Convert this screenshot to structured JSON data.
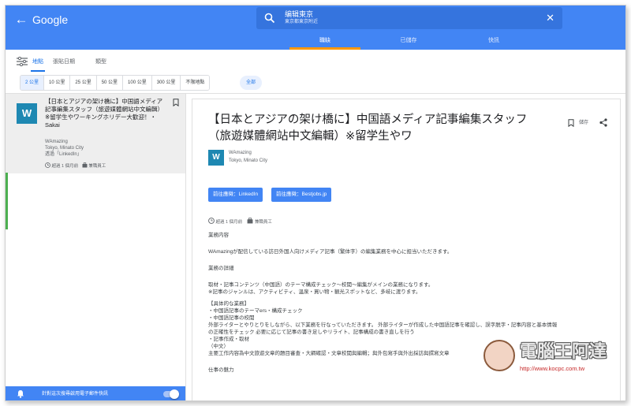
{
  "header": {
    "brand": "Google",
    "search_title": "编辑東京",
    "search_sub": "東京都東京附近",
    "tabs": [
      {
        "label": "職缺"
      },
      {
        "label": "已儲存"
      },
      {
        "label": "快訊"
      }
    ]
  },
  "filters": {
    "tabs": [
      {
        "label": "地點"
      },
      {
        "label": "張貼日期"
      },
      {
        "label": "類型"
      }
    ],
    "distances": [
      {
        "label": "2 公里"
      },
      {
        "label": "10 公里"
      },
      {
        "label": "25 公里"
      },
      {
        "label": "50 公里"
      },
      {
        "label": "100 公里"
      },
      {
        "label": "300 公里"
      },
      {
        "label": "不限地點"
      }
    ],
    "all_label": "全部"
  },
  "list": {
    "card": {
      "logo_letter": "W",
      "title": "【日本とアジアの架け橋に】中国語メディア記事編集スタッフ（旅遊媒體網站中文編輯）※留学生やワーキングホリデー大歓迎！・Sakai",
      "company": "WAmazing",
      "location": "Tokyo, Minato City",
      "via": "透過「LinkedIn」",
      "posted": "超過 1 個月前",
      "type": "full-time"
    },
    "type_label": "兼職員工"
  },
  "notify": {
    "text": "針對這次搜尋啟用電子郵件快訊"
  },
  "detail": {
    "title": "【日本とアジアの架け橋に】中国語メディア記事編集スタッフ（旅遊媒體網站中文編輯）※留学生やワ",
    "save_label": "儲存",
    "logo_letter": "W",
    "company": "WAmazing",
    "location": "Tokyo, Minato City",
    "apply": [
      {
        "label": "前往應徵：LinkedIn"
      },
      {
        "label": "前往應徵：Bestjobs.jp"
      }
    ],
    "posted": "超過 1 個月前",
    "type_label": "兼職員工",
    "body": [
      {
        "text": "業務内容"
      },
      {
        "text": ""
      },
      {
        "text": "WAmazingが配信している訪日外国人向けメディア記事（繁体字）の編集業務を中心に担当いただきます。"
      },
      {
        "text": ""
      },
      {
        "text": "業務の詳細"
      },
      {
        "text": ""
      },
      {
        "text": "取材・記事コンテンツ（中国語）のテーマ構成チェック〜校閲〜編集がメインの業務になります。"
      },
      {
        "text": "※記事のジャンルは、アクティビティ、温泉・買い物・観光スポットなど、多岐に渡ります。"
      },
      {
        "text": ""
      },
      {
        "text": "【具体的な業務】"
      },
      {
        "text": "・中国語記事のテーマers・構成チェック"
      },
      {
        "text": "・中国語記事の校閲"
      },
      {
        "text": "外部ライターとやりとりをしながら、以下業務を行なっていただきます。 外部ライターが作成した中国語記事を確認し、誤字脱字・記事内容と基本情報"
      },
      {
        "text": "の正確性をチェック 必要に応じて記事の書き足しやリライト、記事構成の書き直しを行う"
      },
      {
        "text": "・記事作成・取材"
      },
      {
        "text": "（中文）"
      },
      {
        "text": "主要工作内容為中文旅遊文章的題目審查・大綱確認・文章校閲與編輯；與外包寫手與外出採訪與撰寫文章"
      },
      {
        "text": ""
      },
      {
        "text": "仕事の魅力"
      }
    ]
  },
  "watermark": {
    "title": "電腦王阿達",
    "url": "http://www.kocpc.com.tw"
  },
  "colors": {
    "header_blue": "#4285f4",
    "accent_orange": "#ff9800",
    "logo_teal": "#1e88b2",
    "selected_green": "#4caf50"
  }
}
